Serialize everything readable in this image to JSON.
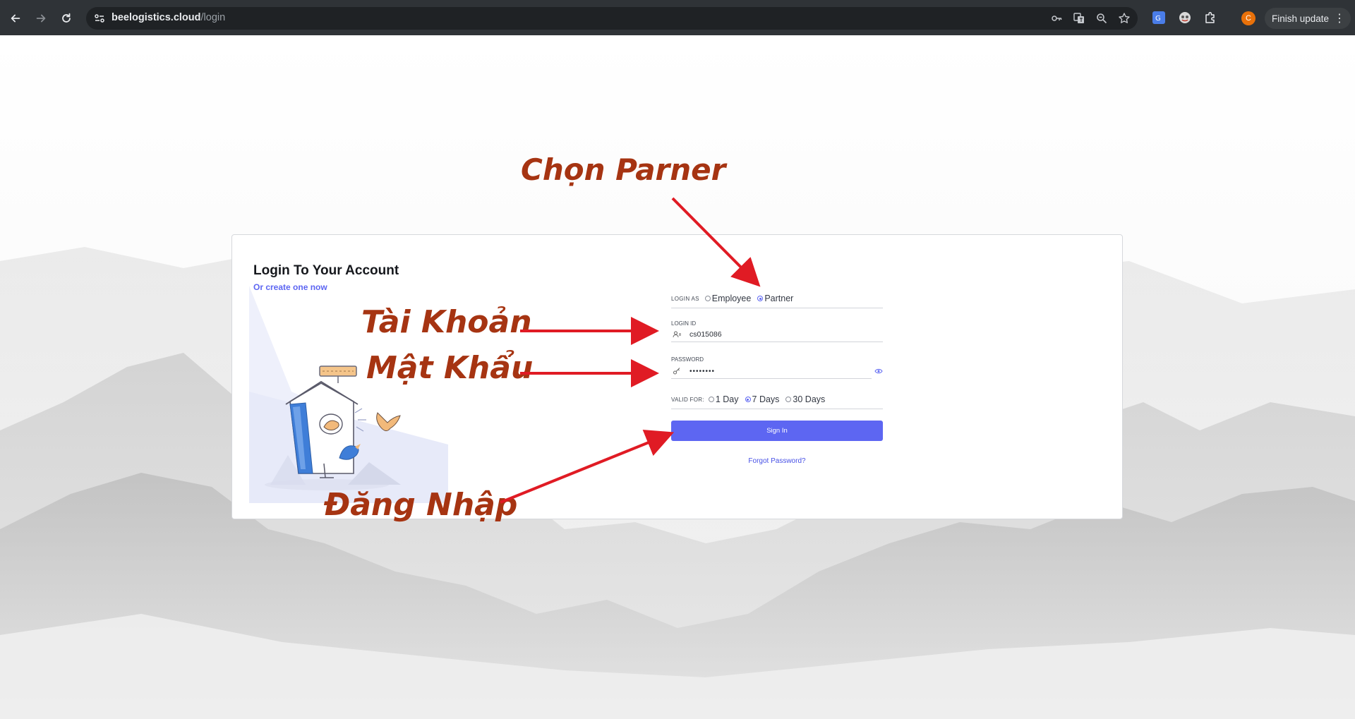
{
  "browser": {
    "url_host": "beelogistics.cloud",
    "url_path": "/login",
    "avatar_letter": "C",
    "finish_update_label": "Finish update",
    "menu_glyph": "⋮",
    "icons": [
      "back-arrow-icon",
      "forward-arrow-icon",
      "reload-icon",
      "site-settings-icon",
      "password-key-icon",
      "translate-icon",
      "zoom-icon",
      "bookmark-star-icon",
      "google-translate-extension-icon",
      "extension-icon",
      "extensions-puzzle-icon"
    ]
  },
  "login_card": {
    "title": "Login To Your Account",
    "subtitle": "Or create one now",
    "login_as_label": "LOGIN AS",
    "login_as_options": [
      {
        "label": "Employee",
        "selected": false
      },
      {
        "label": "Partner",
        "selected": true
      }
    ],
    "login_id_label": "LOGIN ID",
    "login_id_value": "cs015086",
    "password_label": "PASSWORD",
    "password_value": "••••••••",
    "valid_for_label": "VALID FOR:",
    "valid_for_options": [
      {
        "label": "1 Day",
        "selected": false
      },
      {
        "label": "7 Days",
        "selected": true
      },
      {
        "label": "30 Days",
        "selected": false
      }
    ],
    "sign_in_label": "Sign In",
    "forgot_password_label": "Forgot Password?"
  },
  "annotations": {
    "choose_partner": "Chọn Parner",
    "account": "Tài Khoản",
    "password": "Mật Khẩu",
    "login": "Đăng Nhập"
  },
  "colors": {
    "accent": "#5d66f2",
    "annotation_text": "#a63412",
    "annotation_arrow": "#e01b24",
    "chrome_bg": "#2f3337"
  }
}
